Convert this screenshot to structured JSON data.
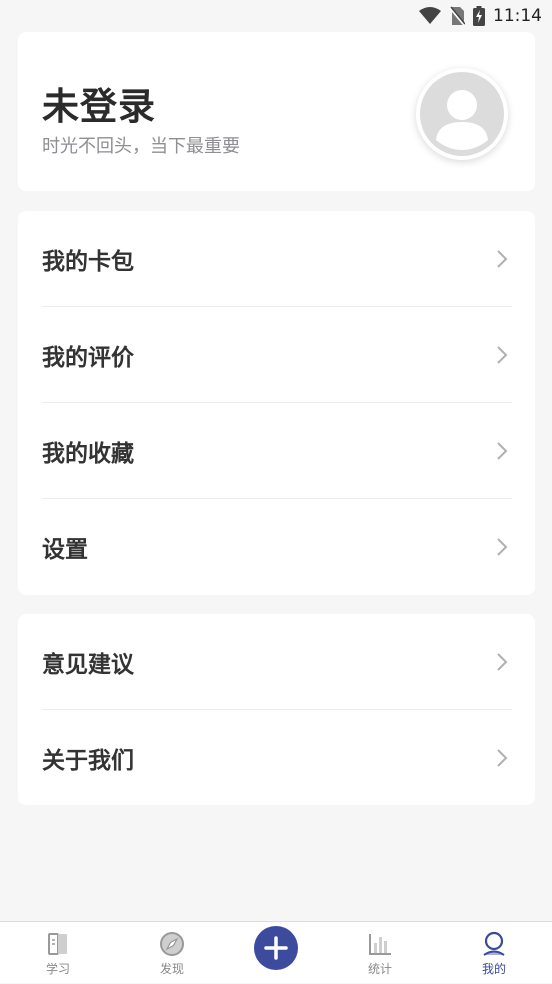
{
  "status_bar": {
    "time": "11:14",
    "icons": [
      "wifi-icon",
      "no-sim-icon",
      "battery-charging-icon"
    ]
  },
  "profile": {
    "name": "未登录",
    "motto": "时光不回头，当下最重要",
    "avatar_icon": "user-avatar-icon"
  },
  "menu_group_1": {
    "items": [
      {
        "label": "我的卡包"
      },
      {
        "label": "我的评价"
      },
      {
        "label": "我的收藏"
      },
      {
        "label": "设置"
      }
    ]
  },
  "menu_group_2": {
    "items": [
      {
        "label": "意见建议"
      },
      {
        "label": "关于我们"
      }
    ]
  },
  "tab_bar": {
    "tabs": [
      {
        "label": "学习",
        "icon": "book-icon"
      },
      {
        "label": "发现",
        "icon": "compass-icon"
      },
      {
        "label": "",
        "icon": "plus-icon"
      },
      {
        "label": "统计",
        "icon": "bar-chart-icon"
      },
      {
        "label": "我的",
        "icon": "user-icon"
      }
    ],
    "active_tab": "我的"
  },
  "colors": {
    "accent": "#3d4b9e",
    "background": "#f6f6f7",
    "card": "#ffffff",
    "muted_text": "#8e8e93",
    "inactive_tab": "#888888"
  }
}
